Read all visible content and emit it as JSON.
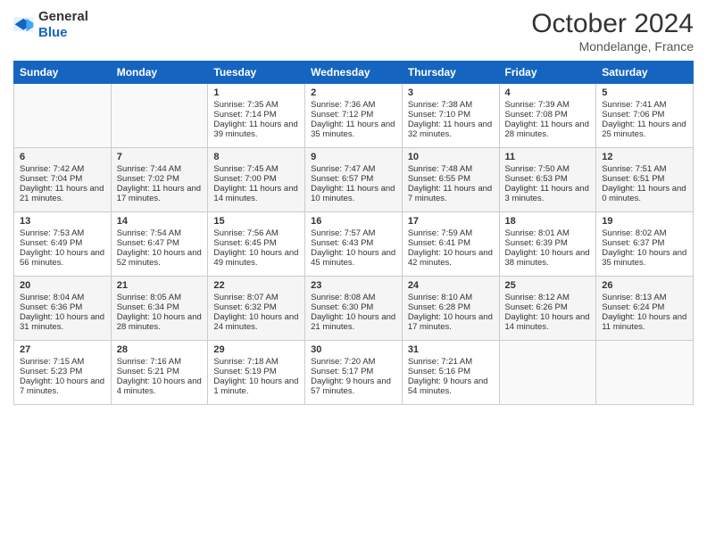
{
  "header": {
    "logo_general": "General",
    "logo_blue": "Blue",
    "month_year": "October 2024",
    "location": "Mondelange, France"
  },
  "days_of_week": [
    "Sunday",
    "Monday",
    "Tuesday",
    "Wednesday",
    "Thursday",
    "Friday",
    "Saturday"
  ],
  "weeks": [
    [
      {
        "day": "",
        "sunrise": "",
        "sunset": "",
        "daylight": ""
      },
      {
        "day": "",
        "sunrise": "",
        "sunset": "",
        "daylight": ""
      },
      {
        "day": "1",
        "sunrise": "Sunrise: 7:35 AM",
        "sunset": "Sunset: 7:14 PM",
        "daylight": "Daylight: 11 hours and 39 minutes."
      },
      {
        "day": "2",
        "sunrise": "Sunrise: 7:36 AM",
        "sunset": "Sunset: 7:12 PM",
        "daylight": "Daylight: 11 hours and 35 minutes."
      },
      {
        "day": "3",
        "sunrise": "Sunrise: 7:38 AM",
        "sunset": "Sunset: 7:10 PM",
        "daylight": "Daylight: 11 hours and 32 minutes."
      },
      {
        "day": "4",
        "sunrise": "Sunrise: 7:39 AM",
        "sunset": "Sunset: 7:08 PM",
        "daylight": "Daylight: 11 hours and 28 minutes."
      },
      {
        "day": "5",
        "sunrise": "Sunrise: 7:41 AM",
        "sunset": "Sunset: 7:06 PM",
        "daylight": "Daylight: 11 hours and 25 minutes."
      }
    ],
    [
      {
        "day": "6",
        "sunrise": "Sunrise: 7:42 AM",
        "sunset": "Sunset: 7:04 PM",
        "daylight": "Daylight: 11 hours and 21 minutes."
      },
      {
        "day": "7",
        "sunrise": "Sunrise: 7:44 AM",
        "sunset": "Sunset: 7:02 PM",
        "daylight": "Daylight: 11 hours and 17 minutes."
      },
      {
        "day": "8",
        "sunrise": "Sunrise: 7:45 AM",
        "sunset": "Sunset: 7:00 PM",
        "daylight": "Daylight: 11 hours and 14 minutes."
      },
      {
        "day": "9",
        "sunrise": "Sunrise: 7:47 AM",
        "sunset": "Sunset: 6:57 PM",
        "daylight": "Daylight: 11 hours and 10 minutes."
      },
      {
        "day": "10",
        "sunrise": "Sunrise: 7:48 AM",
        "sunset": "Sunset: 6:55 PM",
        "daylight": "Daylight: 11 hours and 7 minutes."
      },
      {
        "day": "11",
        "sunrise": "Sunrise: 7:50 AM",
        "sunset": "Sunset: 6:53 PM",
        "daylight": "Daylight: 11 hours and 3 minutes."
      },
      {
        "day": "12",
        "sunrise": "Sunrise: 7:51 AM",
        "sunset": "Sunset: 6:51 PM",
        "daylight": "Daylight: 11 hours and 0 minutes."
      }
    ],
    [
      {
        "day": "13",
        "sunrise": "Sunrise: 7:53 AM",
        "sunset": "Sunset: 6:49 PM",
        "daylight": "Daylight: 10 hours and 56 minutes."
      },
      {
        "day": "14",
        "sunrise": "Sunrise: 7:54 AM",
        "sunset": "Sunset: 6:47 PM",
        "daylight": "Daylight: 10 hours and 52 minutes."
      },
      {
        "day": "15",
        "sunrise": "Sunrise: 7:56 AM",
        "sunset": "Sunset: 6:45 PM",
        "daylight": "Daylight: 10 hours and 49 minutes."
      },
      {
        "day": "16",
        "sunrise": "Sunrise: 7:57 AM",
        "sunset": "Sunset: 6:43 PM",
        "daylight": "Daylight: 10 hours and 45 minutes."
      },
      {
        "day": "17",
        "sunrise": "Sunrise: 7:59 AM",
        "sunset": "Sunset: 6:41 PM",
        "daylight": "Daylight: 10 hours and 42 minutes."
      },
      {
        "day": "18",
        "sunrise": "Sunrise: 8:01 AM",
        "sunset": "Sunset: 6:39 PM",
        "daylight": "Daylight: 10 hours and 38 minutes."
      },
      {
        "day": "19",
        "sunrise": "Sunrise: 8:02 AM",
        "sunset": "Sunset: 6:37 PM",
        "daylight": "Daylight: 10 hours and 35 minutes."
      }
    ],
    [
      {
        "day": "20",
        "sunrise": "Sunrise: 8:04 AM",
        "sunset": "Sunset: 6:36 PM",
        "daylight": "Daylight: 10 hours and 31 minutes."
      },
      {
        "day": "21",
        "sunrise": "Sunrise: 8:05 AM",
        "sunset": "Sunset: 6:34 PM",
        "daylight": "Daylight: 10 hours and 28 minutes."
      },
      {
        "day": "22",
        "sunrise": "Sunrise: 8:07 AM",
        "sunset": "Sunset: 6:32 PM",
        "daylight": "Daylight: 10 hours and 24 minutes."
      },
      {
        "day": "23",
        "sunrise": "Sunrise: 8:08 AM",
        "sunset": "Sunset: 6:30 PM",
        "daylight": "Daylight: 10 hours and 21 minutes."
      },
      {
        "day": "24",
        "sunrise": "Sunrise: 8:10 AM",
        "sunset": "Sunset: 6:28 PM",
        "daylight": "Daylight: 10 hours and 17 minutes."
      },
      {
        "day": "25",
        "sunrise": "Sunrise: 8:12 AM",
        "sunset": "Sunset: 6:26 PM",
        "daylight": "Daylight: 10 hours and 14 minutes."
      },
      {
        "day": "26",
        "sunrise": "Sunrise: 8:13 AM",
        "sunset": "Sunset: 6:24 PM",
        "daylight": "Daylight: 10 hours and 11 minutes."
      }
    ],
    [
      {
        "day": "27",
        "sunrise": "Sunrise: 7:15 AM",
        "sunset": "Sunset: 5:23 PM",
        "daylight": "Daylight: 10 hours and 7 minutes."
      },
      {
        "day": "28",
        "sunrise": "Sunrise: 7:16 AM",
        "sunset": "Sunset: 5:21 PM",
        "daylight": "Daylight: 10 hours and 4 minutes."
      },
      {
        "day": "29",
        "sunrise": "Sunrise: 7:18 AM",
        "sunset": "Sunset: 5:19 PM",
        "daylight": "Daylight: 10 hours and 1 minute."
      },
      {
        "day": "30",
        "sunrise": "Sunrise: 7:20 AM",
        "sunset": "Sunset: 5:17 PM",
        "daylight": "Daylight: 9 hours and 57 minutes."
      },
      {
        "day": "31",
        "sunrise": "Sunrise: 7:21 AM",
        "sunset": "Sunset: 5:16 PM",
        "daylight": "Daylight: 9 hours and 54 minutes."
      },
      {
        "day": "",
        "sunrise": "",
        "sunset": "",
        "daylight": ""
      },
      {
        "day": "",
        "sunrise": "",
        "sunset": "",
        "daylight": ""
      }
    ]
  ]
}
